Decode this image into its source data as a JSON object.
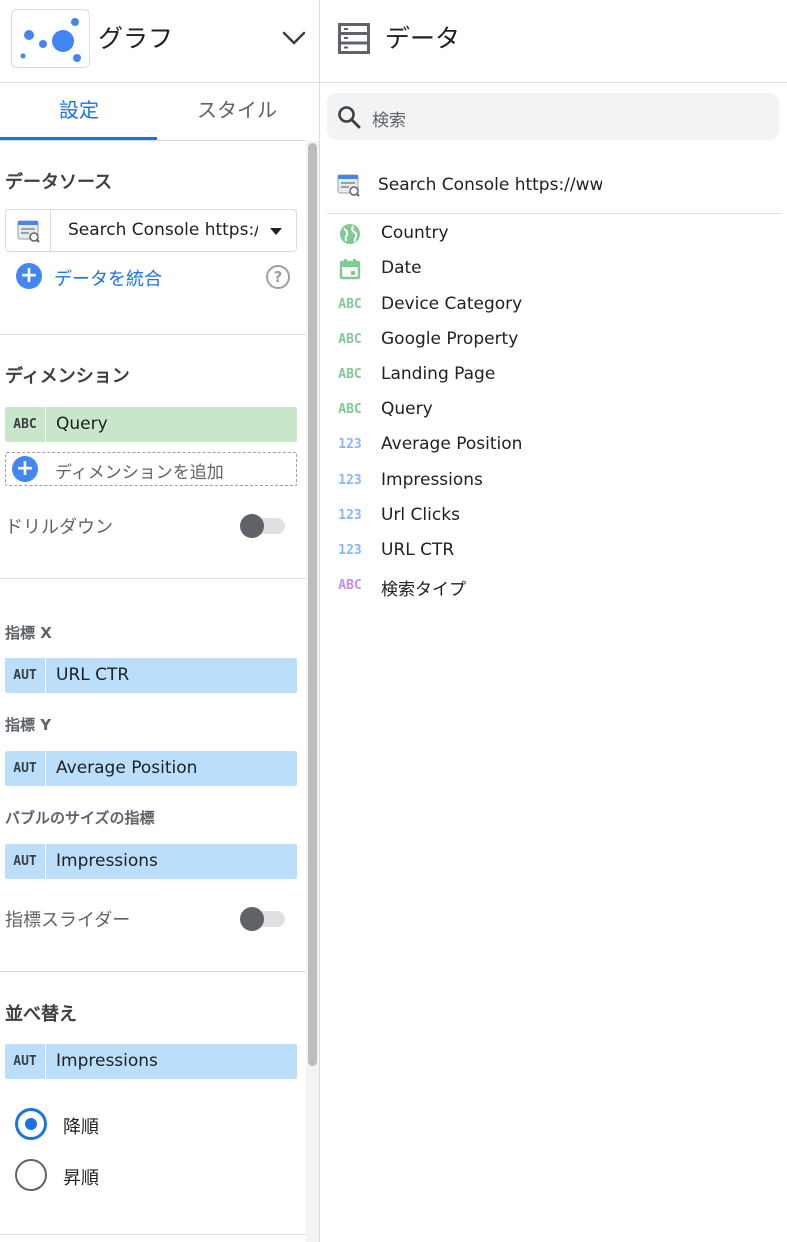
{
  "left_panel": {
    "chart_type_label": "グラフ",
    "tabs": [
      {
        "label": "設定",
        "active": true
      },
      {
        "label": "スタイル",
        "active": false
      }
    ],
    "data_source": {
      "title": "データソース",
      "selected": "Search Console https:/...",
      "blend_label": "データを統合",
      "help_glyph": "?"
    },
    "dimension": {
      "title": "ディメンション",
      "chip": {
        "type": "ABC",
        "label": "Query"
      },
      "add_label": "ディメンションを追加",
      "drilldown_label": "ドリルダウン",
      "drilldown_on": false
    },
    "metrics": {
      "x_title": "指標 X",
      "x_chip": {
        "type": "AUT",
        "label": "URL CTR"
      },
      "y_title": "指標 Y",
      "y_chip": {
        "type": "AUT",
        "label": "Average Position"
      },
      "size_title": "バブルのサイズの指標",
      "size_chip": {
        "type": "AUT",
        "label": "Impressions"
      },
      "slider_label": "指標スライダー",
      "slider_on": false
    },
    "sort": {
      "title": "並べ替え",
      "chip": {
        "type": "AUT",
        "label": "Impressions"
      },
      "options": [
        {
          "label": "降順",
          "selected": true
        },
        {
          "label": "昇順",
          "selected": false
        }
      ]
    }
  },
  "right_panel": {
    "title": "データ",
    "search_placeholder": "検索",
    "data_source_name": "Search Console https://www.",
    "fields": [
      {
        "type_icon": "globe-icon",
        "type_text": "",
        "label": "Country",
        "color": "#81c995"
      },
      {
        "type_icon": "calendar-icon",
        "type_text": "",
        "label": "Date",
        "color": "#81c995"
      },
      {
        "type_icon": "text-type-icon",
        "type_text": "ABC",
        "label": "Device Category",
        "color": "#81c995"
      },
      {
        "type_icon": "text-type-icon",
        "type_text": "ABC",
        "label": "Google Property",
        "color": "#81c995"
      },
      {
        "type_icon": "text-type-icon",
        "type_text": "ABC",
        "label": "Landing Page",
        "color": "#81c995"
      },
      {
        "type_icon": "text-type-icon",
        "type_text": "ABC",
        "label": "Query",
        "color": "#81c995"
      },
      {
        "type_icon": "number-type-icon",
        "type_text": "123",
        "label": "Average Position",
        "color": "#8ab4f8"
      },
      {
        "type_icon": "number-type-icon",
        "type_text": "123",
        "label": "Impressions",
        "color": "#8ab4f8"
      },
      {
        "type_icon": "number-type-icon",
        "type_text": "123",
        "label": "Url Clicks",
        "color": "#8ab4f8"
      },
      {
        "type_icon": "number-type-icon",
        "type_text": "123",
        "label": "URL CTR",
        "color": "#8ab4f8"
      },
      {
        "type_icon": "text-type-icon",
        "type_text": "ABC",
        "label": "検索タイプ",
        "color": "#c58af9"
      }
    ]
  },
  "colors": {
    "accent": "#1a73e8",
    "dimension_chip": "#c8e6c9",
    "metric_chip": "#bbdefb"
  }
}
